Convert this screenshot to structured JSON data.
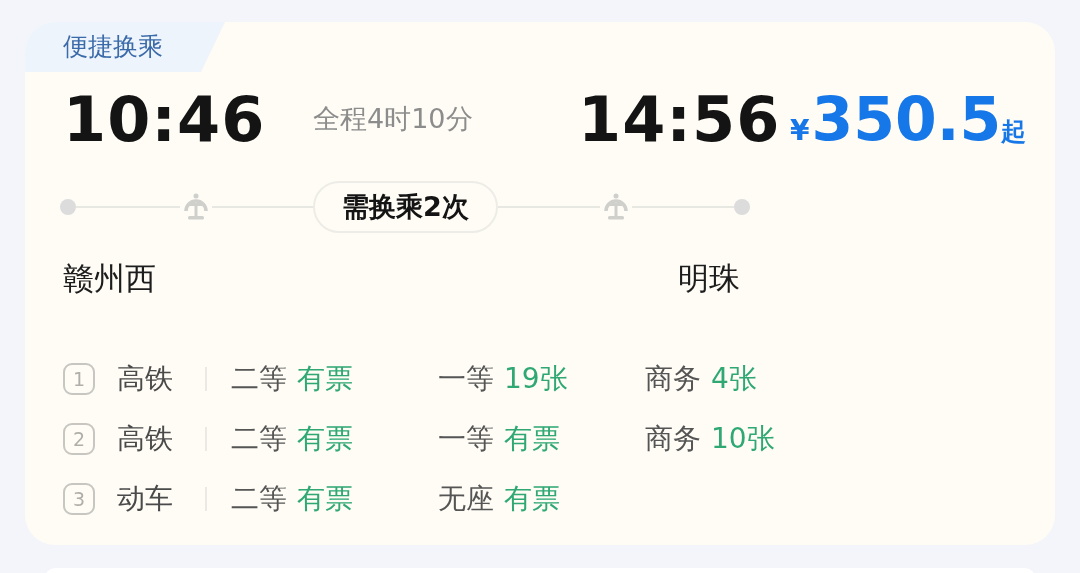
{
  "badge": "便捷换乘",
  "depart_time": "10:46",
  "duration": "全程4时10分",
  "arrive_time": "14:56",
  "price": {
    "currency": "¥",
    "amount": "350.5",
    "suffix": "起"
  },
  "transfer_badge": "需换乘2次",
  "from_station": "赣州西",
  "to_station": "明珠",
  "legs": [
    {
      "index": "1",
      "train_type": "高铁",
      "seats": [
        {
          "class": "二等",
          "availability": "有票"
        },
        {
          "class": "一等",
          "availability": "19张"
        },
        {
          "class": "商务",
          "availability": "4张"
        }
      ]
    },
    {
      "index": "2",
      "train_type": "高铁",
      "seats": [
        {
          "class": "二等",
          "availability": "有票"
        },
        {
          "class": "一等",
          "availability": "有票"
        },
        {
          "class": "商务",
          "availability": "10张"
        }
      ]
    },
    {
      "index": "3",
      "train_type": "动车",
      "seats": [
        {
          "class": "二等",
          "availability": "有票"
        },
        {
          "class": "无座",
          "availability": "有票"
        }
      ]
    }
  ]
}
